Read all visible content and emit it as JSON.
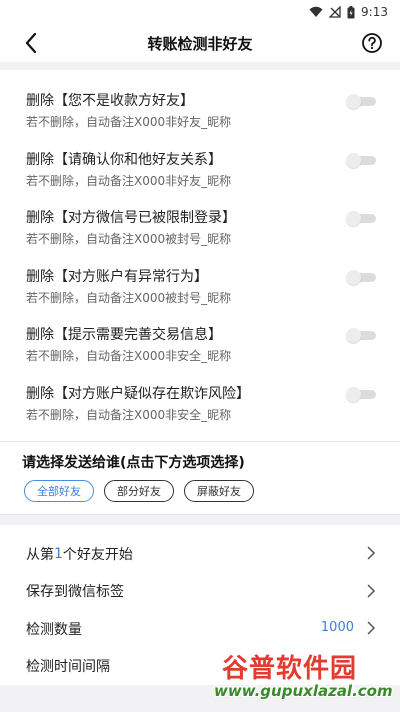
{
  "status_bar": {
    "time": "9:13"
  },
  "app_bar": {
    "title": "转账检测非好友"
  },
  "delete_options": [
    {
      "title": "删除【您不是收款方好友】",
      "subtitle": "若不删除，自动备注X000非好友_昵称",
      "enabled": false
    },
    {
      "title": "删除【请确认你和他好友关系】",
      "subtitle": "若不删除，自动备注X000非好友_昵称",
      "enabled": false
    },
    {
      "title": "删除【对方微信号已被限制登录】",
      "subtitle": "若不删除，自动备注X000被封号_昵称",
      "enabled": false
    },
    {
      "title": "删除【对方账户有异常行为】",
      "subtitle": "若不删除，自动备注X000被封号_昵称",
      "enabled": false
    },
    {
      "title": "删除【提示需要完善交易信息】",
      "subtitle": "若不删除，自动备注X000非安全_昵称",
      "enabled": false
    },
    {
      "title": "删除【对方账户疑似存在欺诈风险】",
      "subtitle": "若不删除，自动备注X000非安全_昵称",
      "enabled": false
    }
  ],
  "recipient": {
    "heading": "请选择发送给谁(点击下方选项选择)",
    "options": [
      "全部好友",
      "部分好友",
      "屏蔽好友"
    ],
    "selected": "全部好友"
  },
  "settings": {
    "start_from": {
      "prefix": "从第",
      "number": "1",
      "suffix": "个好友开始"
    },
    "save_tag": {
      "label": "保存到微信标签"
    },
    "count": {
      "label": "检测数量",
      "value": "1000"
    },
    "interval": {
      "label": "检测时间间隔"
    }
  },
  "watermark": {
    "title": "谷普软件园",
    "url": "www.gupuxlazal.com"
  },
  "colors": {
    "accent": "#3d7fd6",
    "background": "#f2f2f4",
    "watermark_red": "#e33b2f",
    "watermark_green": "#3a8a2c"
  }
}
